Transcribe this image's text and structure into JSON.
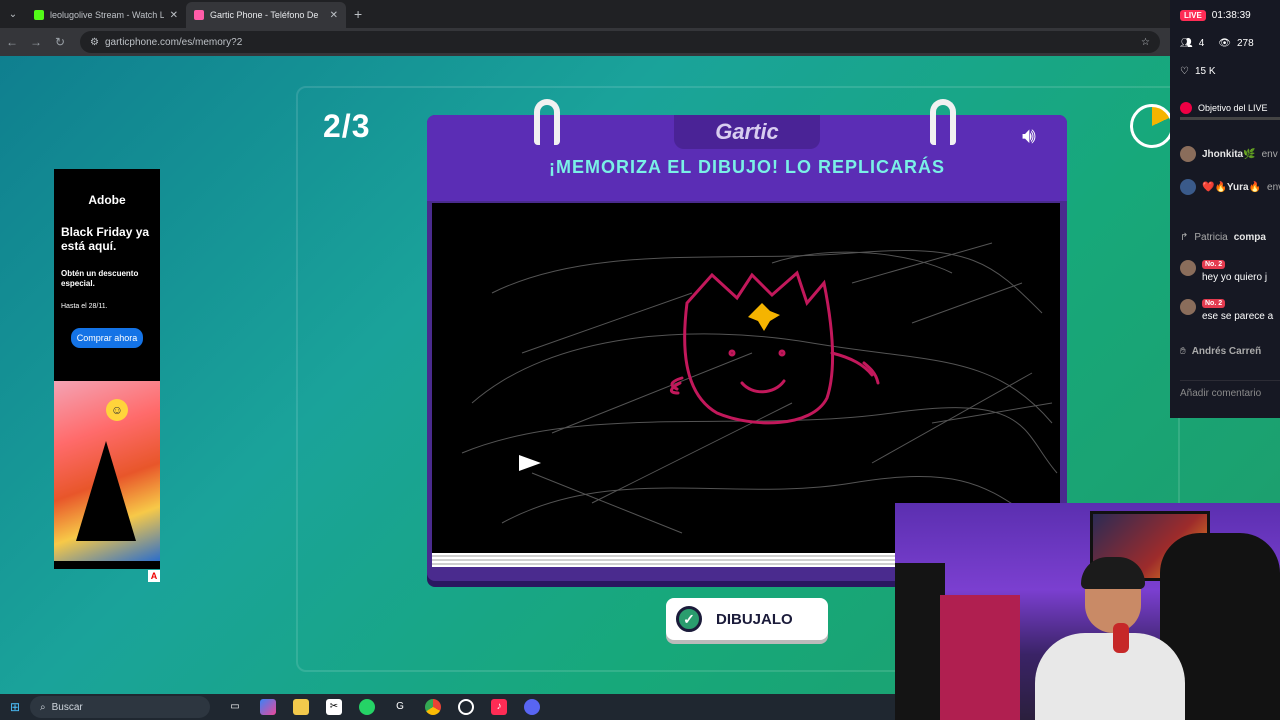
{
  "browser": {
    "tabs": [
      {
        "title": "leolugolive Stream - Watch Live",
        "favicon_color": "#53fc18"
      },
      {
        "title": "Gartic Phone - Teléfono De",
        "favicon_color": "#ff5ca8"
      }
    ],
    "url": "garticphone.com/es/memory?2"
  },
  "game": {
    "round": "2/3",
    "logo": "Gartic",
    "instruction": "¡MEMORIZA EL DIBUJO! LO REPLICARÁS",
    "button_label": "DIBUJALO"
  },
  "ad": {
    "brand": "Adobe",
    "headline": "Black Friday ya está aquí.",
    "subtext": "Obtén un descuento especial.",
    "date": "Hasta el 28/11.",
    "cta": "Comprar ahora"
  },
  "live": {
    "badge": "LIVE",
    "time": "01:38:39",
    "viewers": "4",
    "views": "278",
    "likes": "15 K",
    "goal": "Objetivo del LIVE",
    "chat": [
      {
        "user": "Jhonkita🌿",
        "text": "env"
      },
      {
        "user": "❤️🔥Yura🔥",
        "text": "env"
      },
      {
        "user": "Patricia",
        "text": "compa"
      },
      {
        "user": "No. 2",
        "text": "hey yo quiero j"
      },
      {
        "user": "No. 2",
        "text": "ese se parece a"
      },
      {
        "user": "Andrés Carreñ",
        "text": ""
      }
    ],
    "comment_placeholder": "Añadir comentario"
  },
  "taskbar": {
    "search_placeholder": "Buscar"
  }
}
